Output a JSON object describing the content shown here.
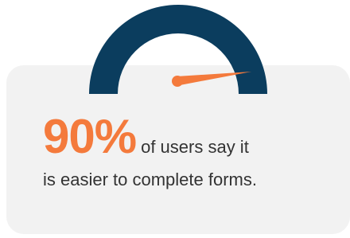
{
  "stat": {
    "value": "90%",
    "text_line_1": "of users say it",
    "text_line_2": "is easier to complete forms."
  },
  "gauge": {
    "level_percent": 90,
    "icon": "speedometer-gauge-icon"
  },
  "colors": {
    "arc": "#0b3d5e",
    "needle": "#f47a3c",
    "card_background": "#f2f2f2",
    "text": "#333333"
  }
}
